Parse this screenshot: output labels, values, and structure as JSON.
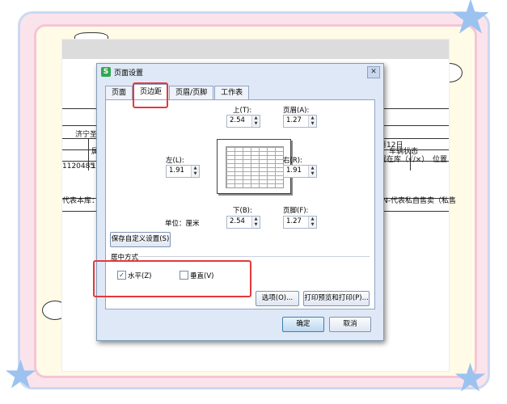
{
  "dialog": {
    "title": "页面设置",
    "app_logo": "S",
    "close_glyph": "✕",
    "tabs": [
      "页面",
      "页边距",
      "页眉/页脚",
      "工作表"
    ],
    "active_tab": "页边距",
    "margins": {
      "top_label": "上(T):",
      "top_value": "2.54",
      "header_label": "页眉(A):",
      "header_value": "1.27",
      "left_label": "左(L):",
      "left_value": "1.91",
      "right_label": "右(R):",
      "right_value": "1.91",
      "bottom_label": "下(B):",
      "bottom_value": "2.54",
      "footer_label": "页脚(F):",
      "footer_value": "1.27",
      "unit_label": "单位：厘米"
    },
    "save_custom_button": "保存自定义设置(S)",
    "center_section": {
      "title": "居中方式",
      "horizontal_label": "水平(Z)",
      "horizontal_checked": true,
      "vertical_label": "垂直(V)",
      "vertical_checked": false
    },
    "options_button": "选项(O)...",
    "print_preview_button": "打印预览和打印(P)...",
    "ok_button": "确定",
    "cancel_button": "取消"
  },
  "background_doc": {
    "left_texts": [
      "济宁圣",
      "属",
      "1120485",
      "12",
      "代表本库：C"
    ],
    "right_texts": [
      "月12日",
      "车辆状态",
      "置在库（√/×）",
      "位置",
      "N-代表私自售卖（私售"
    ]
  },
  "colors": {
    "highlight": "#e4393c",
    "dialog_bg": "#dfe8f6",
    "star": "#9cc3f0"
  }
}
